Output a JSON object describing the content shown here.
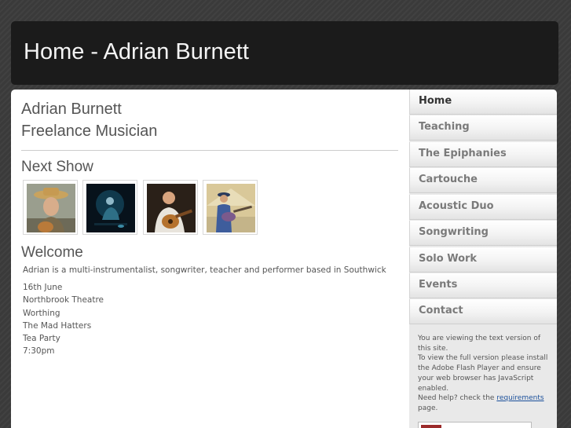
{
  "header": {
    "title": "Home - Adrian Burnett"
  },
  "main": {
    "name": "Adrian Burnett",
    "role": "Freelance Musician",
    "next_show_heading": "Next Show",
    "welcome_heading": "Welcome",
    "intro": "Adrian is a multi-instrumentalist, songwriter, teacher and performer based in Southwick",
    "show_lines": [
      "16th June",
      "Northbrook Theatre",
      "Worthing",
      "The Mad Hatters",
      "Tea Party",
      "7:30pm"
    ]
  },
  "nav": {
    "items": [
      {
        "label": "Home",
        "active": true
      },
      {
        "label": "Teaching"
      },
      {
        "label": "The Epiphanies"
      },
      {
        "label": "Cartouche"
      },
      {
        "label": "Acoustic Duo"
      },
      {
        "label": "Songwriting"
      },
      {
        "label": "Solo Work"
      },
      {
        "label": "Events"
      },
      {
        "label": "Contact"
      }
    ]
  },
  "sidebar_note": {
    "line1": "You are viewing the text version of this site.",
    "line2": "To view the full version please install the Adobe Flash Player and ensure your web browser has JavaScript enabled.",
    "line3_prefix": "Need help? check the ",
    "line3_link": "requirements",
    "line3_suffix": " page."
  }
}
